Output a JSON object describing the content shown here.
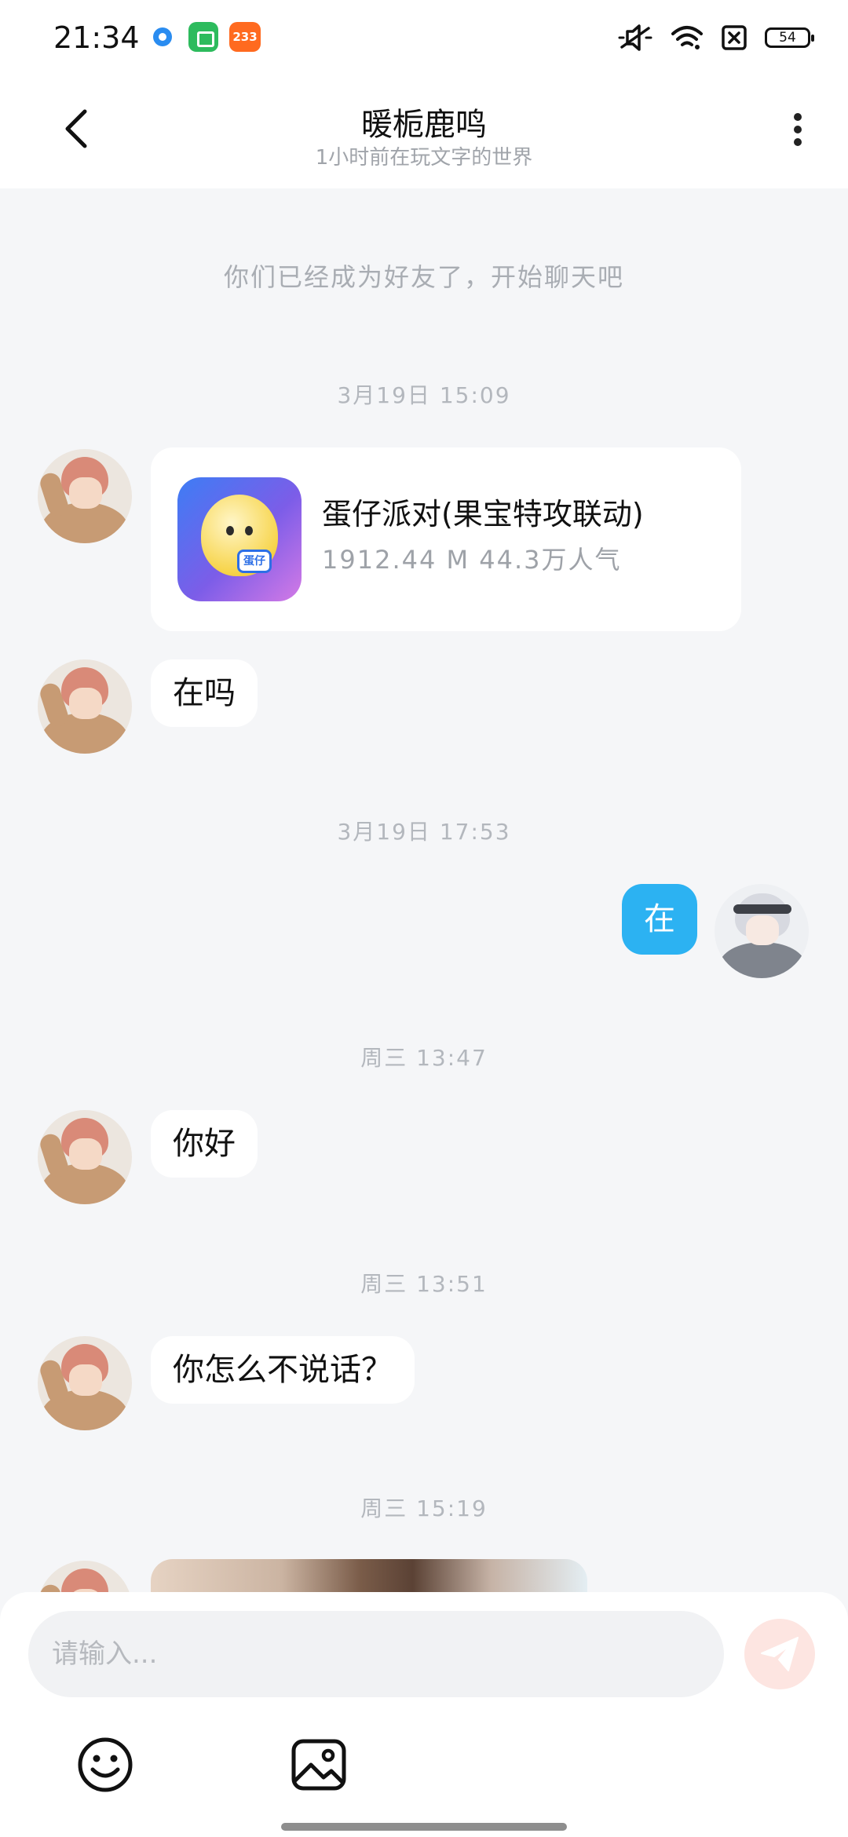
{
  "status_bar": {
    "time": "21:34",
    "app_badge_3": "233",
    "battery": "54",
    "icons": [
      "mute-icon",
      "wifi-icon",
      "sim-off-icon",
      "battery-icon"
    ]
  },
  "header": {
    "title": "暖栀鹿鸣",
    "subtitle": "1小时前在玩文字的世界"
  },
  "chat": {
    "system_notice": "你们已经成为好友了，开始聊天吧",
    "timestamps": [
      "3月19日 15:09",
      "3月19日 17:53",
      "周三 13:47",
      "周三 13:51",
      "周三 15:19"
    ],
    "game_card": {
      "title": "蛋仔派对(果宝特攻联动)",
      "meta": "1912.44 M 44.3万人气",
      "icon_badge": "蛋仔"
    },
    "messages": [
      {
        "from": "friend",
        "text": "在吗"
      },
      {
        "from": "me",
        "text": "在"
      },
      {
        "from": "friend",
        "text": "你好"
      },
      {
        "from": "friend",
        "text": "你怎么不说话？"
      }
    ]
  },
  "composer": {
    "placeholder": "请输入...",
    "value": ""
  },
  "colors": {
    "my_bubble": "#2cb2f2",
    "background": "#f5f6f8",
    "send_button": "#fde5e1"
  }
}
